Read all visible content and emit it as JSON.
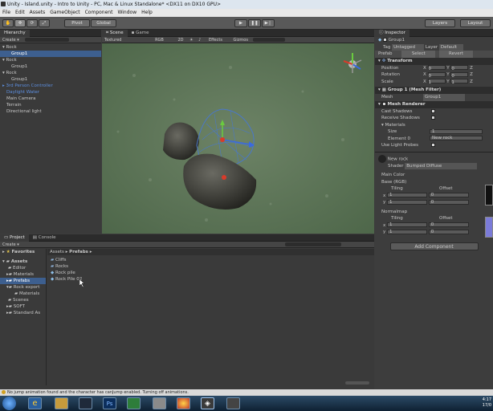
{
  "window": {
    "title": "Unity - Island.unity - Intro to Unity - PC, Mac & Linux Standalone* <DX11 on DX10 GPU>"
  },
  "menu": [
    "File",
    "Edit",
    "Assets",
    "GameObject",
    "Component",
    "Window",
    "Help"
  ],
  "toolbar": {
    "pivot": "Pivot",
    "global": "Global",
    "layers": "Layers",
    "layout": "Layout"
  },
  "hierarchy": {
    "tab": "Hierarchy",
    "create": "Create",
    "items": [
      "Rock",
      "Group1",
      "Rock",
      "Group1",
      "Rock",
      "Group1",
      "3rd Person Controller",
      "Daylight Water",
      "Main Camera",
      "Terrain",
      "Directional light"
    ]
  },
  "scene": {
    "tab_scene": "Scene",
    "tab_game": "Game",
    "mode": "Textured",
    "rgb": "RGB",
    "two_d": "2D",
    "effects": "Effects",
    "gizmos": "Gizmos"
  },
  "project": {
    "tab_project": "Project",
    "tab_console": "Console",
    "create": "Create",
    "favorites": "Favorites",
    "assets": "Assets",
    "tree": [
      "Editor",
      "Materials",
      "Prefabs",
      "Rock export",
      "Materials",
      "Scenes",
      "SOFT",
      "Standard As"
    ],
    "breadcrumb": [
      "Assets",
      "Prefabs"
    ],
    "files": [
      "Cliffs",
      "Rocks",
      "Rock pile",
      "Rock Pile 02"
    ]
  },
  "inspector": {
    "tab": "Inspector",
    "name": "Group1",
    "tag_label": "Tag",
    "tag": "Untagged",
    "layer_label": "Layer",
    "layer": "Default",
    "prefab_label": "Prefab",
    "select": "Select",
    "revert": "Revert",
    "transform": "Transform",
    "position": "Position",
    "rotation": "Rotation",
    "scale": "Scale",
    "x": "X",
    "y": "Y",
    "z": "Z",
    "pos": [
      "0",
      "0",
      "0"
    ],
    "rot": [
      "0",
      "0",
      "0"
    ],
    "scl": [
      "1",
      "1",
      "1"
    ],
    "mesh_filter": "Group 1 (Mesh Filter)",
    "mesh_label": "Mesh",
    "mesh": "Group1",
    "mesh_renderer": "Mesh Renderer",
    "cast": "Cast Shadows",
    "receive": "Receive Shadows",
    "materials": "Materials",
    "size": "Size",
    "size_val": "1",
    "element": "Element 0",
    "element_val": "New rock",
    "light_probes": "Use Light Probes",
    "mat_name": "New rock",
    "shader_label": "Shader",
    "shader": "Bumped Diffuse",
    "main_color": "Main Color",
    "base": "Base (RGB)",
    "tiling": "Tiling",
    "offset": "Offset",
    "tile_x": "1",
    "tile_y": "1",
    "off_x": "0",
    "off_y": "0",
    "normalmap": "Normalmap",
    "add_component": "Add Component"
  },
  "status": {
    "message": "No jump animation found and the character has canJump enabled. Turning off animations."
  },
  "clock": {
    "time": "4:17",
    "date": "17/0"
  }
}
